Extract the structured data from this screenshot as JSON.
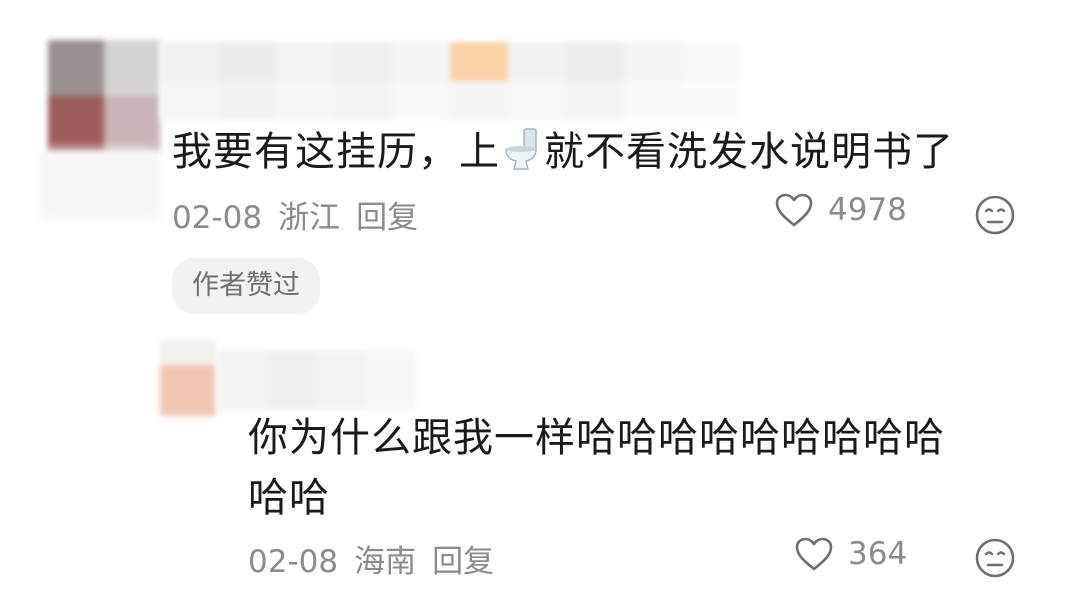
{
  "comments": [
    {
      "text": "我要有这挂历，上",
      "text_after_emoji": "就不看洗发水说明书了",
      "emoji": "toilet-emoji",
      "date": "02-08",
      "location": "浙江",
      "reply_label": "回复",
      "likes": "4978",
      "author_badge": "作者赞过"
    },
    {
      "text_line1": "你为什么跟我一样哈哈哈哈哈哈哈哈哈",
      "text_line2": "哈哈",
      "date": "02-08",
      "location": "海南",
      "reply_label": "回复",
      "likes": "364"
    }
  ],
  "colors": {
    "meta": "#8a8b91",
    "text": "#1a1a1a",
    "badge_bg": "#f2f2f4"
  },
  "icons": [
    "heart-outline-icon",
    "dislike-face-icon",
    "toilet-emoji"
  ]
}
